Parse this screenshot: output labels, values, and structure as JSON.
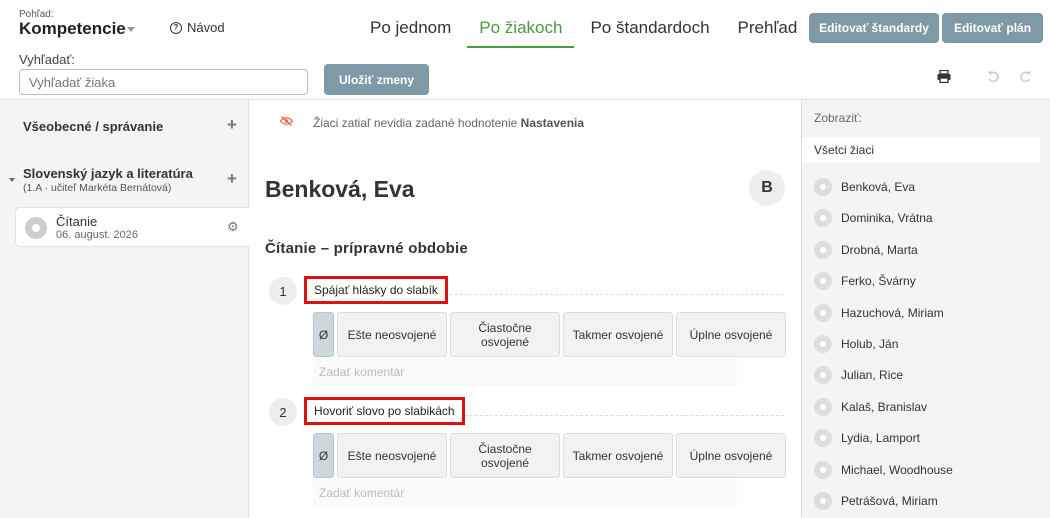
{
  "header": {
    "view_label": "Pohľad:",
    "view_value": "Kompetencie",
    "help_label": "Návod",
    "tabs": [
      {
        "label": "Po jednom",
        "active": false
      },
      {
        "label": "Po žiakoch",
        "active": true
      },
      {
        "label": "Po štandardoch",
        "active": false
      },
      {
        "label": "Prehľad",
        "active": false
      }
    ],
    "edit_standards_label": "Editovať štandardy",
    "edit_plan_label": "Editovať plán",
    "search_label": "Vyhľadať:",
    "search_placeholder": "Vyhľadať žiaka",
    "save_label": "Uložiť zmeny",
    "icons": {
      "print": "print-icon",
      "undo": "undo-icon",
      "redo": "redo-icon"
    }
  },
  "left_panel": {
    "subjects": [
      {
        "title": "Všeobecné / správanie",
        "subtitle": ""
      },
      {
        "title": "Slovenský jazyk a literatúra",
        "subtitle": "(1.A · učiteľ Markéta Bernátová)"
      }
    ],
    "lesson": {
      "name": "Čítanie",
      "date": "06. august. 2026"
    }
  },
  "main": {
    "notice_text": "Žiaci zatiaľ nevidia zadané hodnotenie",
    "notice_link": "Nastavenia",
    "student_name": "Benková, Eva",
    "student_badge": "B",
    "section_title": "Čítanie – prípravné obdobie",
    "grade_none": "Ø",
    "grades": [
      "Ešte neosvojené",
      "Čiastočne osvojené",
      "Takmer osvojené",
      "Úplne osvojené"
    ],
    "comment_placeholder": "Zadať komentár",
    "competencies": [
      {
        "number": "1",
        "label": "Spájať hlásky do slabík"
      },
      {
        "number": "2",
        "label": "Hovoriť slovo po slabikách"
      }
    ]
  },
  "right_panel": {
    "show_label": "Zobraziť:",
    "show_value": "Všetci žiaci",
    "students": [
      "Benková, Eva",
      "Dominika, Vrátna",
      "Drobná, Marta",
      "Ferko, Švárny",
      "Hazuchová, Miriam",
      "Holub, Ján",
      "Julian, Rice",
      "Kalaš, Branislav",
      "Lydia, Lamport",
      "Michael, Woodhouse",
      "Petrášová, Miriam"
    ]
  }
}
